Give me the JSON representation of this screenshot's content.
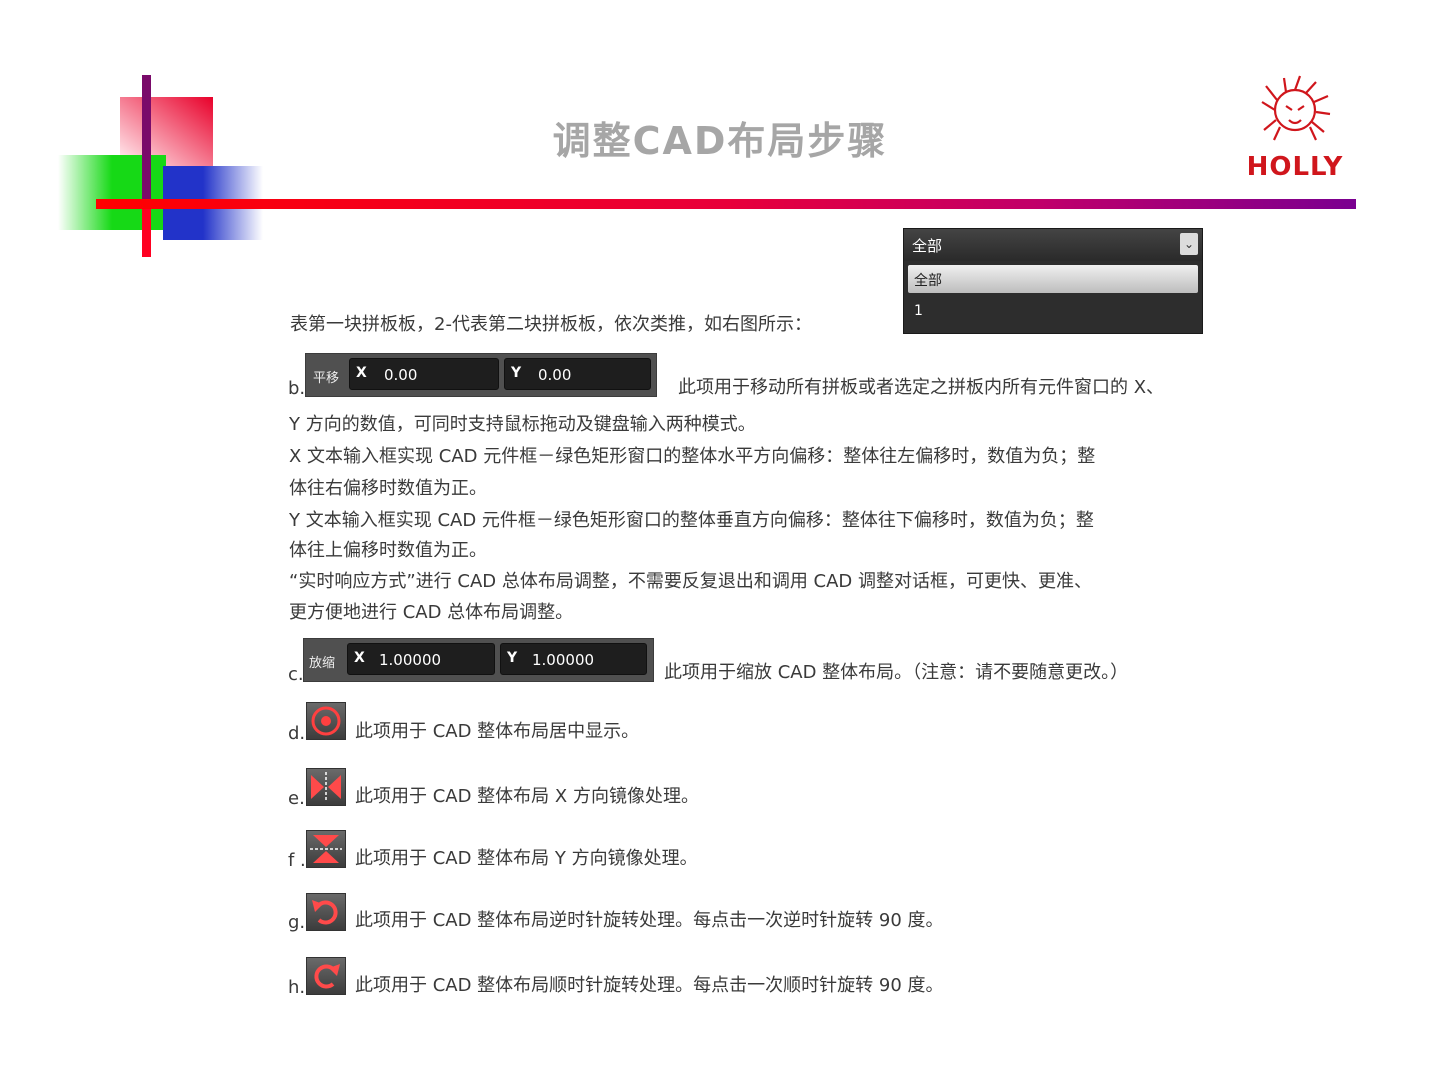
{
  "header": {
    "title": "调整CAD布局步骤",
    "logo_text": "HOLLY"
  },
  "dropdown": {
    "selected": "全部",
    "options": [
      "全部",
      "1"
    ]
  },
  "intro_line": "表第一块拼板板，2-代表第二块拼板板，依次类推，如右图所示：",
  "b": {
    "marker": "b.",
    "tag": "平移",
    "x_label": "X",
    "x_value": "0.00",
    "y_label": "Y",
    "y_value": "0.00",
    "line1": "此项用于移动所有拼板或者选定之拼板内所有元件窗口的 X、",
    "lines": [
      "Y 方向的数值，可同时支持鼠标拖动及键盘输入两种模式。",
      "X 文本输入框实现 CAD 元件框－绿色矩形窗口的整体水平方向偏移：整体往左偏移时，数值为负；整",
      "体往右偏移时数值为正。",
      "Y 文本输入框实现 CAD 元件框－绿色矩形窗口的整体垂直方向偏移：整体往下偏移时，数值为负；整",
      "体往上偏移时数值为正。",
      "“实时响应方式”进行 CAD 总体布局调整，不需要反复退出和调用 CAD 调整对话框，可更快、更准、",
      "更方便地进行 CAD 总体布局调整。"
    ]
  },
  "c": {
    "marker": "c.",
    "tag": "放缩",
    "x_label": "X",
    "x_value": "1.00000",
    "y_label": "Y",
    "y_value": "1.00000",
    "text": "此项用于缩放 CAD 整体布局。（注意：请不要随意更改。）"
  },
  "items": [
    {
      "marker": "d.",
      "icon": "center-target-icon",
      "text": "此项用于 CAD 整体布局居中显示。"
    },
    {
      "marker": "e.",
      "icon": "mirror-x-icon",
      "text": "此项用于 CAD 整体布局 X 方向镜像处理。"
    },
    {
      "marker": "f .",
      "icon": "mirror-y-icon",
      "text": "此项用于 CAD 整体布局 Y 方向镜像处理。"
    },
    {
      "marker": "g.",
      "icon": "rotate-ccw-icon",
      "text": "此项用于 CAD 整体布局逆时针旋转处理。每点击一次逆时针旋转 90 度。"
    },
    {
      "marker": "h.",
      "icon": "rotate-cw-icon",
      "text": "此项用于 CAD 整体布局顺时针旋转处理。每点击一次顺时针旋转 90 度。"
    }
  ],
  "colors": {
    "title_gray": "#a6a6a6",
    "brand_red": "#d0161c",
    "icon_red": "#e03030"
  }
}
